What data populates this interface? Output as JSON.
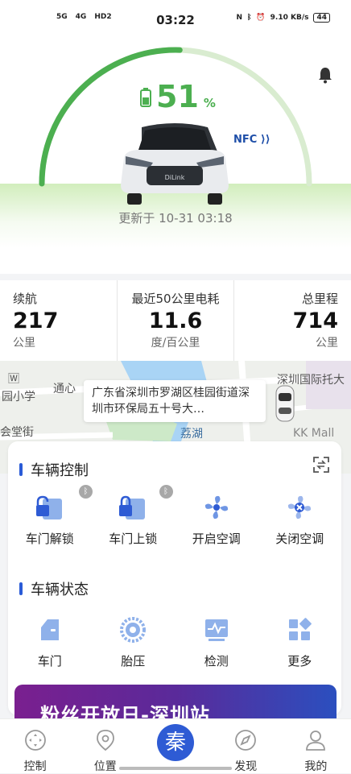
{
  "status_bar": {
    "signal_1": "5G",
    "signal_2": "4G",
    "hd": "HD2",
    "time": "03:22",
    "net_speed": "9.10 KB/s",
    "battery": "44"
  },
  "hero": {
    "battery_percent": "51",
    "battery_unit": "%",
    "battery_level": 0.51,
    "nfc_label": "NFC",
    "updated_text": "更新于 10-31 03:18",
    "car_plate": "DiLink",
    "colors": {
      "battery_green": "#4caf50",
      "arc_track": "#d9ecd0"
    }
  },
  "stats": {
    "range": {
      "label": "续航",
      "value": "217",
      "unit": "公里"
    },
    "consumption": {
      "label": "最近50公里电耗",
      "value": "11.6",
      "unit": "度/百公里"
    },
    "odometer": {
      "label": "总里程",
      "value": "714",
      "unit": "公里"
    }
  },
  "map": {
    "address": "广东省深圳市罗湖区桂园街道深圳市环保局五十号大…",
    "labels": {
      "school": "园小学",
      "tongxin": "通心",
      "hall": "会堂街",
      "lake": "荔湖",
      "tower": "深圳国际托大厦",
      "mall": "KK Mall"
    }
  },
  "vehicle_control": {
    "title": "车辆控制",
    "items": [
      {
        "label": "车门解锁",
        "icon": "door-unlock-icon",
        "bluetooth": true
      },
      {
        "label": "车门上锁",
        "icon": "door-lock-icon",
        "bluetooth": true
      },
      {
        "label": "开启空调",
        "icon": "fan-on-icon",
        "bluetooth": false
      },
      {
        "label": "关闭空调",
        "icon": "fan-off-icon",
        "bluetooth": false
      }
    ]
  },
  "vehicle_status": {
    "title": "车辆状态",
    "items": [
      {
        "label": "车门",
        "icon": "door-icon"
      },
      {
        "label": "胎压",
        "icon": "tire-icon"
      },
      {
        "label": "检测",
        "icon": "diagnostic-icon"
      },
      {
        "label": "更多",
        "icon": "more-grid-icon"
      }
    ]
  },
  "banner": {
    "text": "粉丝开放日-深圳站"
  },
  "tabbar": {
    "items": [
      {
        "label": "控制",
        "icon": "control-icon"
      },
      {
        "label": "位置",
        "icon": "location-icon"
      },
      {
        "label": "秦",
        "icon": "qin-logo-icon"
      },
      {
        "label": "发现",
        "icon": "discover-icon"
      },
      {
        "label": "我的",
        "icon": "profile-icon"
      }
    ]
  }
}
